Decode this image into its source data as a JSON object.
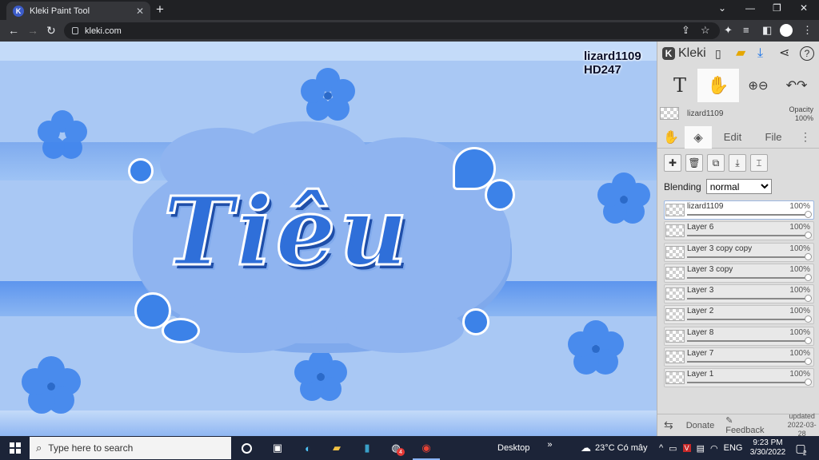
{
  "browser": {
    "tab_title": "Kleki Paint Tool",
    "tab_favicon": "K",
    "url": "kleki.com",
    "icons": [
      "back-icon",
      "forward-icon",
      "reload-icon",
      "share-icon",
      "star-icon",
      "extensions-icon",
      "playlist-icon",
      "sidebar-icon",
      "profile-icon",
      "menu-icon"
    ]
  },
  "canvas": {
    "artwork_text": "Tiêu",
    "watermark_line1": "lizard1109",
    "watermark_line2": "HD247",
    "colors": {
      "background": "#a9c8f4",
      "cloud": "#8fb4f0",
      "text": "#2f6fd9",
      "stripe": "#5d95ee"
    }
  },
  "panel": {
    "logo": "Kleki",
    "tools": [
      "text-tool",
      "hand-tool",
      "zoom-tool",
      "undo-redo"
    ],
    "text_tool_glyph": "T",
    "active_layer_name": "lizard1109",
    "opacity_label": "Opacity",
    "opacity_value": "100%",
    "tabs": {
      "edit": "Edit",
      "file": "File"
    },
    "blending_label": "Blending",
    "blending_value": "normal",
    "layers": [
      {
        "name": "lizard1109",
        "opacity": "100%",
        "selected": true
      },
      {
        "name": "Layer 6",
        "opacity": "100%"
      },
      {
        "name": "Layer 3 copy copy",
        "opacity": "100%"
      },
      {
        "name": "Layer 3 copy",
        "opacity": "100%"
      },
      {
        "name": "Layer 3",
        "opacity": "100%"
      },
      {
        "name": "Layer 2",
        "opacity": "100%"
      },
      {
        "name": "Layer 8",
        "opacity": "100%"
      },
      {
        "name": "Layer 7",
        "opacity": "100%"
      },
      {
        "name": "Layer 1",
        "opacity": "100%"
      }
    ],
    "footer": {
      "donate": "Donate",
      "feedback": "Feedback",
      "updated_label": "updated",
      "updated_date": "2022-03-28"
    }
  },
  "taskbar": {
    "search_placeholder": "Type here to search",
    "desktop_label": "Desktop",
    "weather": "23°C  Có mây",
    "language": "ENG",
    "time": "9:23 PM",
    "date": "3/30/2022",
    "notification_badge": "4",
    "notification_count": "2"
  }
}
